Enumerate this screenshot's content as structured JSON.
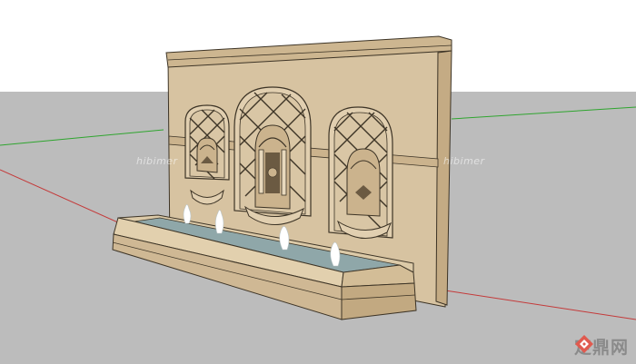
{
  "scene": {
    "subject": "fountain-wall-3d-model",
    "watermark_text": "hibimer",
    "logo_text": "定鼎网"
  },
  "colors": {
    "sky": "#ffffff",
    "ground": "#bcbcbc",
    "stone_light": "#d9c5a3",
    "stone_mid": "#cbb38d",
    "stone_dark": "#a8916c",
    "outline": "#3d3426",
    "water": "#8fa7a9",
    "axis_green": "#2fa52f",
    "axis_red": "#c43a3a"
  },
  "icons": [
    "logo-mark-icon"
  ]
}
